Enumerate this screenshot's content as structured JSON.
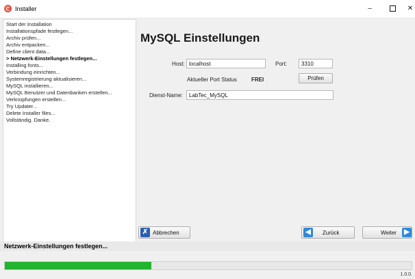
{
  "window": {
    "title": "Installer",
    "controls": {
      "minimize": "–",
      "maximize": "□",
      "close": "✕"
    }
  },
  "steps": [
    "Start der Installation",
    "Installationspfade festlegen...",
    "Archiv prüfen...",
    "Archiv entpacken...",
    "Define client data...",
    "> Netzwerk-Einstellungen festlegen...",
    "Installing fonts...",
    "Verbindung einrichten...",
    "Systemregistrierung aktualisieren...",
    "MySQL installieren...",
    "MySQL Benutzer und Datenbanken erstellen...",
    "Verknüpfungen erstellen...",
    "Try Updater...",
    "Delete Installer files...",
    "Vollständig. Danke."
  ],
  "active_step": 5,
  "main": {
    "heading": "MySQL Einstellungen",
    "host_label": "Host:",
    "host_value": "localhost",
    "port_label": "Port:",
    "port_value": "3310",
    "port_status_label": "Aktueller Port Status",
    "port_status_value": "FREI",
    "check_button": "Prüfen",
    "service_label": "Dienst-Name:",
    "service_value": "LabTec_MySQL"
  },
  "buttons": {
    "cancel": "Abbrechen",
    "back": "Zurück",
    "next": "Weiter"
  },
  "status": {
    "text": "Netzwerk-Einstellungen festlegen...",
    "progress": 0.36,
    "version": "1.0.0."
  },
  "colors": {
    "progress": "#23b42f",
    "cancel_icon": "#2a5fb0",
    "nav_icon": "#2f8ad8"
  }
}
